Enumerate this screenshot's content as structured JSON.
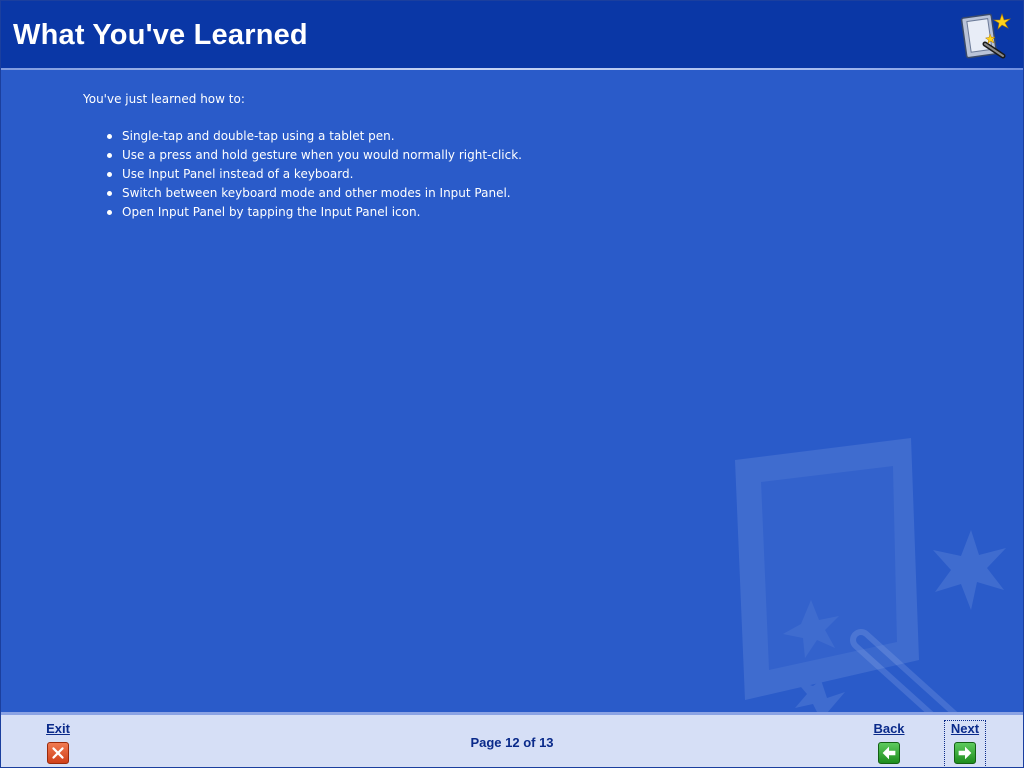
{
  "header": {
    "title": "What You've Learned",
    "logo_icon": "tablet-pen-sparkle-icon"
  },
  "content": {
    "intro": "You've just learned how to:",
    "bullets": [
      "Single-tap and double-tap using a tablet pen.",
      "Use a press and hold gesture when you would normally right-click.",
      "Use Input Panel instead of a keyboard.",
      "Switch between keyboard mode and other modes in Input Panel.",
      "Open Input Panel by tapping the Input Panel icon."
    ],
    "watermark_icon": "tablet-pen-watermark-icon"
  },
  "footer": {
    "exit_label": "Exit",
    "back_label": "Back",
    "next_label": "Next",
    "page_indicator": "Page 12 of 13",
    "exit_icon": "close-icon",
    "back_icon": "arrow-left-icon",
    "next_icon": "arrow-right-icon"
  },
  "colors": {
    "header_bg": "#0a37a6",
    "content_bg": "#2a5bc9",
    "footer_bg": "#d6dff6",
    "footer_text": "#0a2a8a",
    "exit_red": "#d0401a",
    "nav_green": "#1e8c1e"
  }
}
